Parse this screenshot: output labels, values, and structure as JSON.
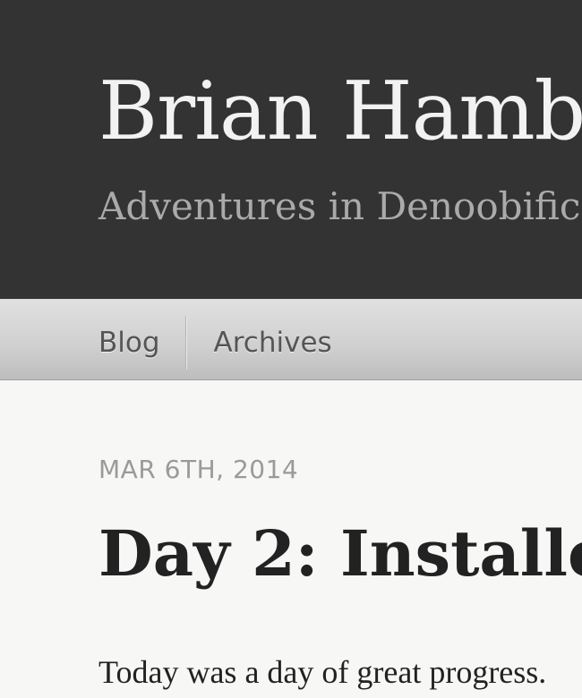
{
  "header": {
    "title": "Brian Hamb",
    "subtitle": "Adventures in Denoobific"
  },
  "nav": {
    "items": [
      {
        "label": "Blog"
      },
      {
        "label": "Archives"
      }
    ]
  },
  "post": {
    "date": "MAR 6TH, 2014",
    "title": "Day 2: Installe",
    "body_first_line": "Today was a day of great progress."
  },
  "colors": {
    "header_bg": "#333333",
    "title_text": "#f2f2f2",
    "subtitle_text": "#aaaaaa",
    "nav_text": "#555555",
    "date_text": "#9a9a9a",
    "body_text": "#222222",
    "page_bg": "#f7f7f6"
  }
}
